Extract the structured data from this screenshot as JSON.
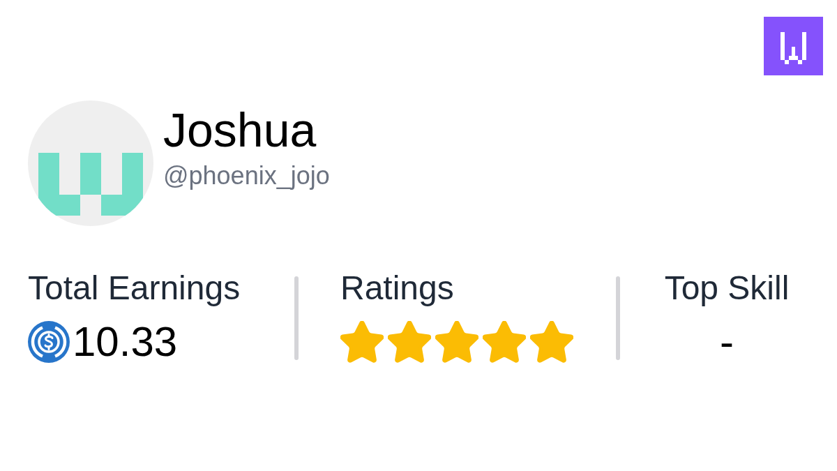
{
  "profile": {
    "name": "Joshua",
    "handle": "@phoenix_jojo"
  },
  "stats": [
    {
      "kind": "earnings",
      "label": "Total Earnings",
      "value": "10.33"
    },
    {
      "kind": "rating",
      "label": "Ratings",
      "stars": 5
    },
    {
      "kind": "skill",
      "label": "Top Skill",
      "value": "-"
    }
  ]
}
